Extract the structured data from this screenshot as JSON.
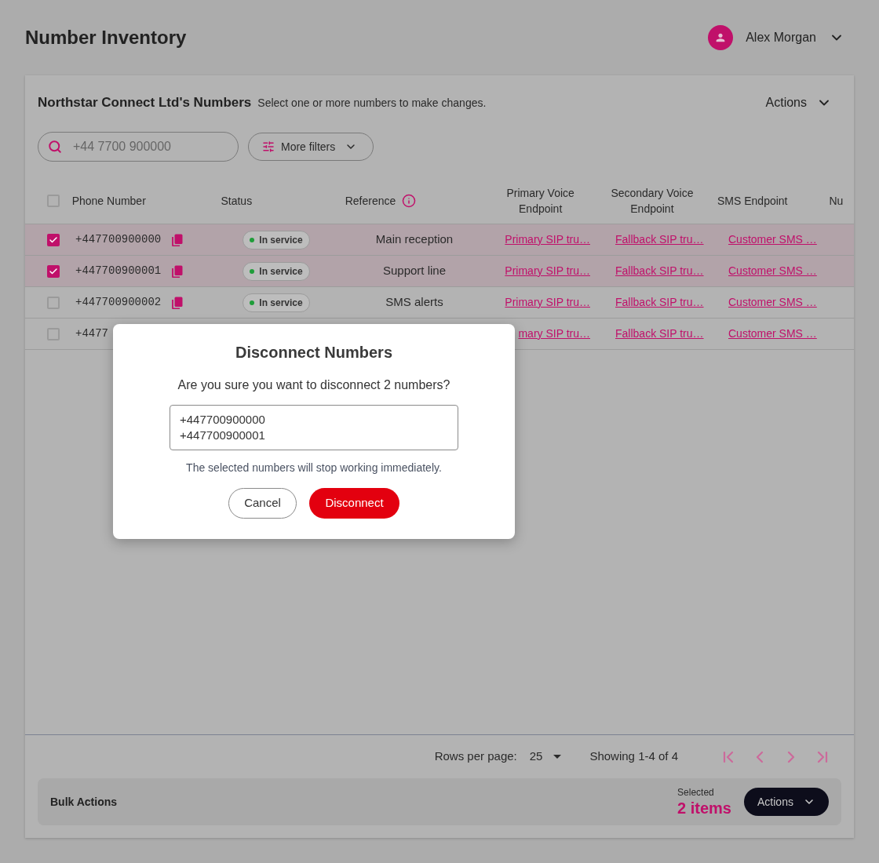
{
  "header": {
    "title": "Number Inventory",
    "user": {
      "name": "Alex Morgan"
    }
  },
  "panel": {
    "title": "Northstar Connect Ltd's Numbers",
    "subtitle": "Select one or more numbers to make changes.",
    "actions": {
      "label": "Actions"
    },
    "search": {
      "placeholder": "+44 7700 900000"
    },
    "filter_button": {
      "label": "More filters"
    },
    "table": {
      "select_all": {
        "checked": false
      },
      "columns": [
        {
          "label": "Phone Number",
          "kind": "text"
        },
        {
          "label": "Status",
          "kind": "text"
        },
        {
          "label": "Reference",
          "kind": "info"
        },
        {
          "label": "Primary Voice Endpoint",
          "kind": "text"
        },
        {
          "label": "Secondary Voice Endpoint",
          "kind": "text"
        },
        {
          "label": "SMS Endpoint",
          "kind": "text"
        },
        {
          "label": "Nu",
          "kind": "text"
        }
      ],
      "rows": [
        {
          "kind": "full",
          "selected": true,
          "phone": "+447700900000",
          "status": "In service",
          "reference": "Main reception",
          "primary": "Primary SIP tru…",
          "secondary": "Fallback SIP tru…",
          "sms": "Customer SMS …"
        },
        {
          "kind": "full",
          "selected": true,
          "phone": "+447700900001",
          "status": "In service",
          "reference": "Support line",
          "primary": "Primary SIP tru…",
          "secondary": "Fallback SIP tru…",
          "sms": "Customer SMS …"
        },
        {
          "kind": "full",
          "selected": false,
          "phone": "+447700900002",
          "status": "In service",
          "reference": "SMS alerts",
          "primary": "Primary SIP tru…",
          "secondary": "Fallback SIP tru…",
          "sms": "Customer SMS …"
        },
        {
          "kind": "covered",
          "selected": false,
          "phone": "+4477",
          "primary": "mary SIP tru…",
          "secondary": "Fallback SIP tru…",
          "sms": "Customer SMS …"
        }
      ]
    },
    "pagination": {
      "rows_per_page_label": "Rows per page:",
      "rows_per_page": "25",
      "range": "Showing 1-4 of 4",
      "buttons": [
        {
          "kind": "first",
          "disabled": true
        },
        {
          "kind": "previous",
          "disabled": true
        },
        {
          "kind": "next",
          "disabled": true
        },
        {
          "kind": "last",
          "disabled": true
        }
      ]
    },
    "bulk_actions": {
      "title": "Bulk Actions",
      "selected_label": "Selected",
      "selected_count": "2 items",
      "button": {
        "label": "Actions"
      }
    }
  },
  "dialog": {
    "title": "Disconnect Numbers",
    "message": "Are you sure you want to disconnect 2 numbers?",
    "numbers": [
      "+447700900000",
      "+447700900001"
    ],
    "note": "The selected numbers will stop working immediately.",
    "buttons": [
      {
        "kind": "secondary",
        "label": "Cancel"
      },
      {
        "kind": "danger",
        "label": "Disconnect"
      }
    ]
  }
}
